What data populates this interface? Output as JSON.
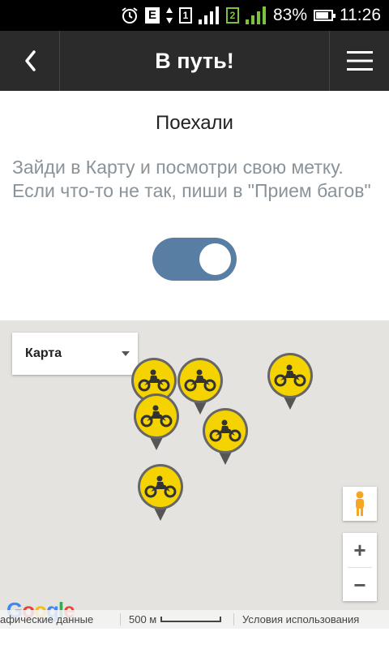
{
  "status_bar": {
    "sim1_label": "1",
    "sim2_label": "2",
    "network_label": "E",
    "battery_percent": "83%",
    "battery_level": 0.83,
    "time": "11:26"
  },
  "app_bar": {
    "title": "В путь!",
    "back_icon": "chevron-left-icon",
    "menu_icon": "hamburger-menu-icon"
  },
  "content": {
    "heading": "Поехали",
    "description": "Зайди в Карту и посмотри свою метку. Если что-то не так, пиши в \"Прием багов\"",
    "toggle_on": true,
    "toggle_color": "#587ea3"
  },
  "map": {
    "map_type_selected": "Карта",
    "marker_color": "#f5d300",
    "marker_icon": "motorcycle-icon",
    "marker_count": 6,
    "attribution_data": "афические данные",
    "scale_label": "500 м",
    "terms_label": "Условия использования",
    "zoom_in_label": "+",
    "zoom_out_label": "−",
    "logo_text": "Google"
  }
}
